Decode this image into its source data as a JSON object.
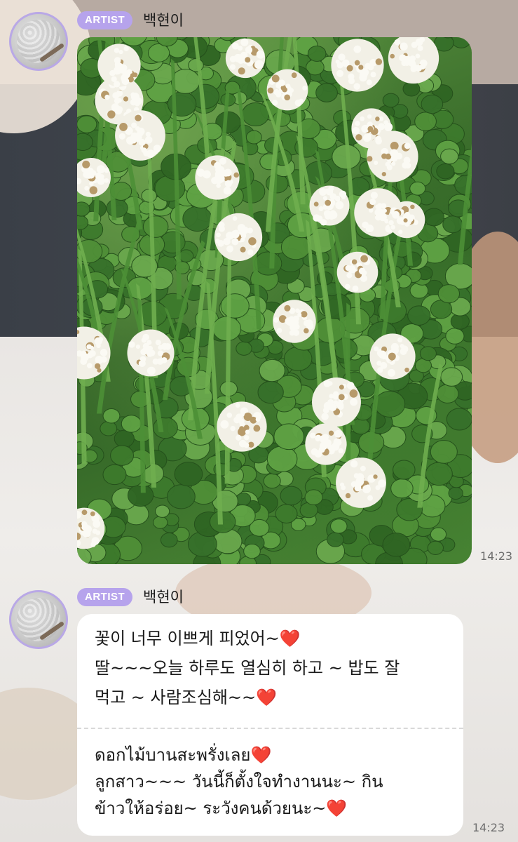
{
  "messages": [
    {
      "badge": "ARTIST",
      "sender": "백현이",
      "type": "image",
      "time": "14:23"
    },
    {
      "badge": "ARTIST",
      "sender": "백현이",
      "type": "text",
      "korean_lines": [
        "꽃이 너무 이쁘게 피었어~❤️",
        "딸~~~오늘 하루도 열심히 하고 ~ 밥도 잘",
        "먹고 ~ 사람조심해~~❤️"
      ],
      "thai_lines": [
        "ดอกไม้บานสะพรั่งเลย❤️",
        "ลูกสาว~~~ วันนี้ก็ตั้งใจทำงานนะ~ กิน",
        "ข้าวให้อร่อย~ ระวังคนด้วยนะ~❤️"
      ],
      "time": "14:23"
    }
  ],
  "colors": {
    "badge": "#b6a3ec",
    "avatar_ring": "#b9a8e6",
    "bubble": "#ffffff",
    "heart": "#e0242f"
  }
}
